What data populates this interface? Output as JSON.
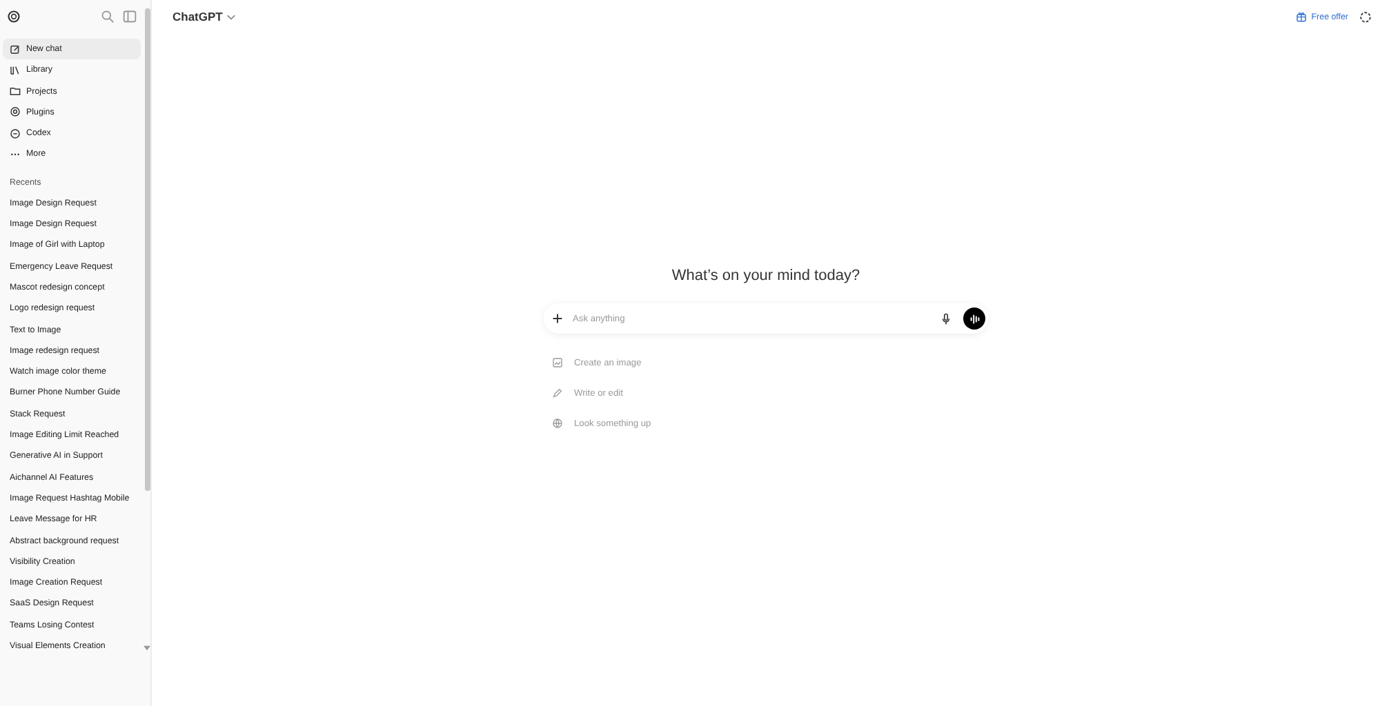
{
  "sidebar": {
    "nav": [
      {
        "label": "New chat",
        "selected": true
      },
      {
        "label": "Library",
        "selected": false
      },
      {
        "label": "Projects",
        "selected": false
      },
      {
        "label": "Plugins",
        "selected": false
      },
      {
        "label": "Codex",
        "selected": false
      },
      {
        "label": "More",
        "selected": false
      }
    ],
    "recents_title": "Recents",
    "recents": [
      "Image Design Request",
      "Image Design Request",
      "Image of Girl with Laptop",
      "Emergency Leave Request",
      "Mascot redesign concept",
      "Logo redesign request",
      "Text to Image",
      "Image redesign request",
      "Watch image color theme",
      "Burner Phone Number Guide",
      "Stack Request",
      "Image Editing Limit Reached",
      "Generative AI in Support",
      "Aichannel AI Features",
      "Image Request Hashtag Mobile",
      "Leave Message for HR",
      "Abstract background request",
      "Visibility Creation",
      "Image Creation Request",
      "SaaS Design Request",
      "Teams Losing Contest",
      "Visual Elements Creation"
    ]
  },
  "header": {
    "title": "ChatGPT",
    "offer": "Free offer"
  },
  "main": {
    "heading": "What’s on your mind today?",
    "composer": {
      "placeholder": "Ask anything"
    },
    "suggestions": [
      "Create an image",
      "Write or edit",
      "Look something up"
    ]
  }
}
